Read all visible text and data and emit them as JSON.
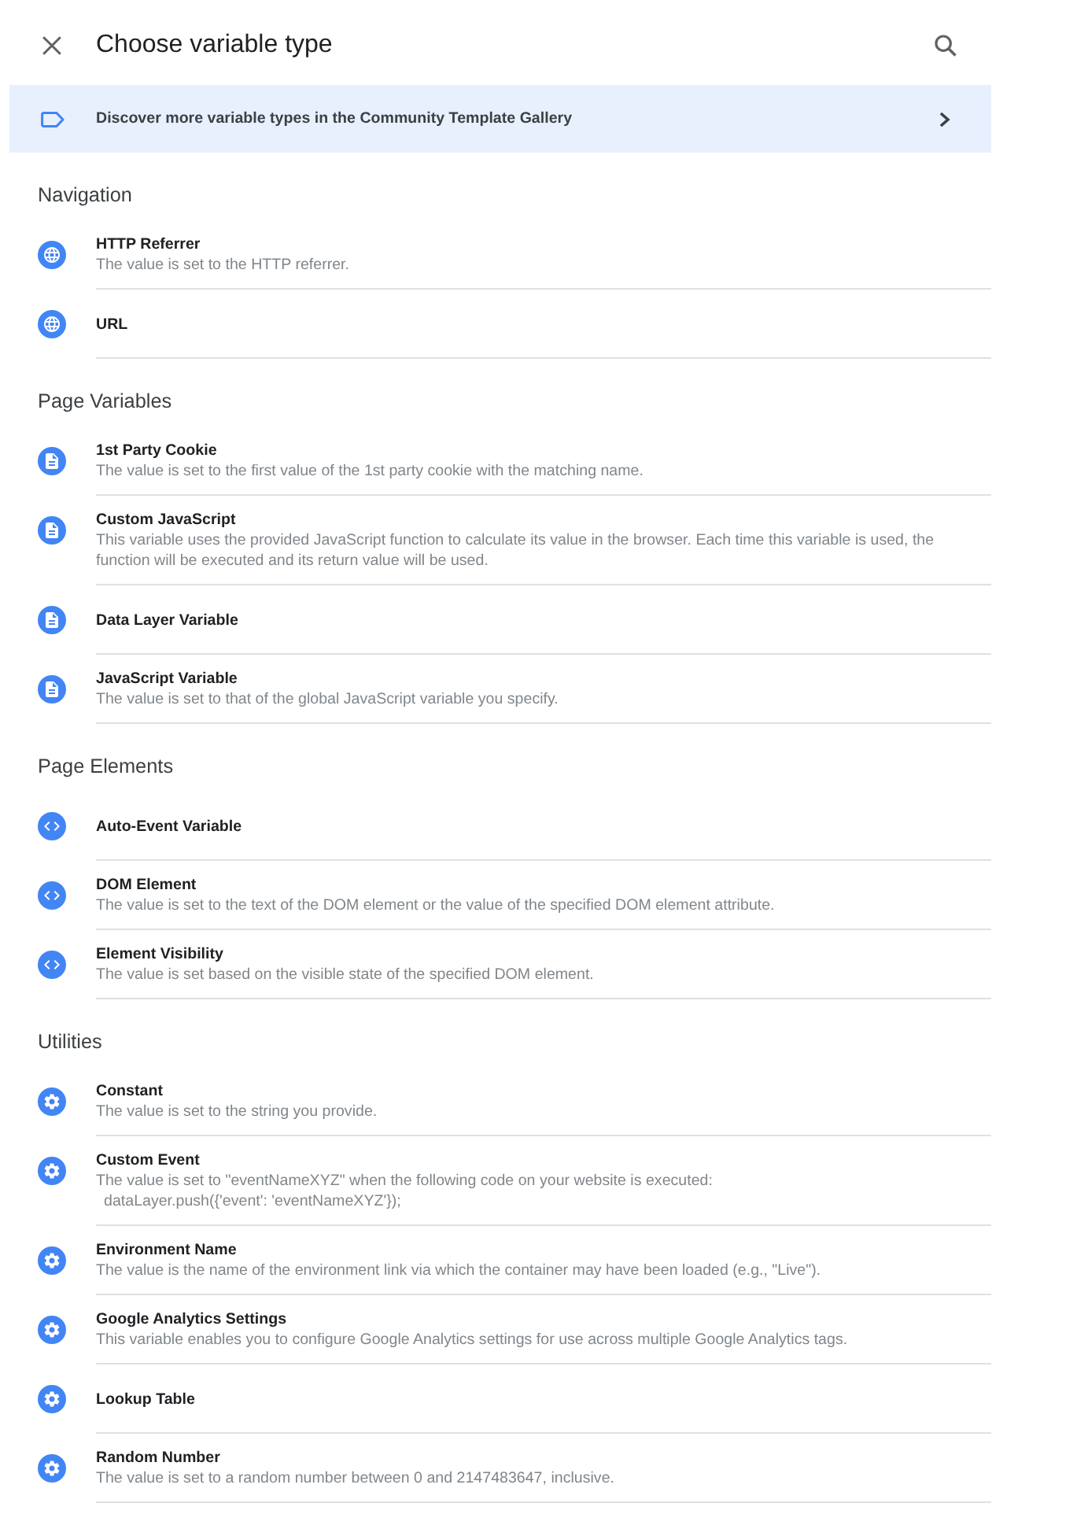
{
  "header": {
    "title": "Choose variable type"
  },
  "banner": {
    "text": "Discover more variable types in the Community Template Gallery"
  },
  "sections": [
    {
      "heading": "Navigation",
      "items": [
        {
          "title": "HTTP Referrer",
          "description": "The value is set to the HTTP referrer."
        },
        {
          "title": "URL"
        }
      ]
    },
    {
      "heading": "Page Variables",
      "items": [
        {
          "title": "1st Party Cookie",
          "description": "The value is set to the first value of the 1st party cookie with the matching name."
        },
        {
          "title": "Custom JavaScript",
          "description": "This variable uses the provided JavaScript function to calculate its value in the browser. Each time this variable is used, the function will be executed and its return value will be used."
        },
        {
          "title": "Data Layer Variable"
        },
        {
          "title": "JavaScript Variable",
          "description": "The value is set to that of the global JavaScript variable you specify."
        }
      ]
    },
    {
      "heading": "Page Elements",
      "items": [
        {
          "title": "Auto-Event Variable"
        },
        {
          "title": "DOM Element",
          "description": "The value is set to the text of the DOM element or the value of the specified DOM element attribute."
        },
        {
          "title": "Element Visibility",
          "description": "The value is set based on the visible state of the specified DOM element."
        }
      ]
    },
    {
      "heading": "Utilities",
      "items": [
        {
          "title": "Constant",
          "description": "The value is set to the string you provide."
        },
        {
          "title": "Custom Event",
          "description": "The value is set to \"eventNameXYZ\" when the following code on your website is executed:",
          "code": "dataLayer.push({'event': 'eventNameXYZ'});"
        },
        {
          "title": "Environment Name",
          "description": "The value is the name of the environment link via which the container may have been loaded (e.g., \"Live\")."
        },
        {
          "title": "Google Analytics Settings",
          "description": "This variable enables you to configure Google Analytics settings for use across multiple Google Analytics tags."
        },
        {
          "title": "Lookup Table"
        },
        {
          "title": "Random Number",
          "description": "The value is set to a random number between 0 and 2147483647, inclusive."
        }
      ]
    }
  ]
}
